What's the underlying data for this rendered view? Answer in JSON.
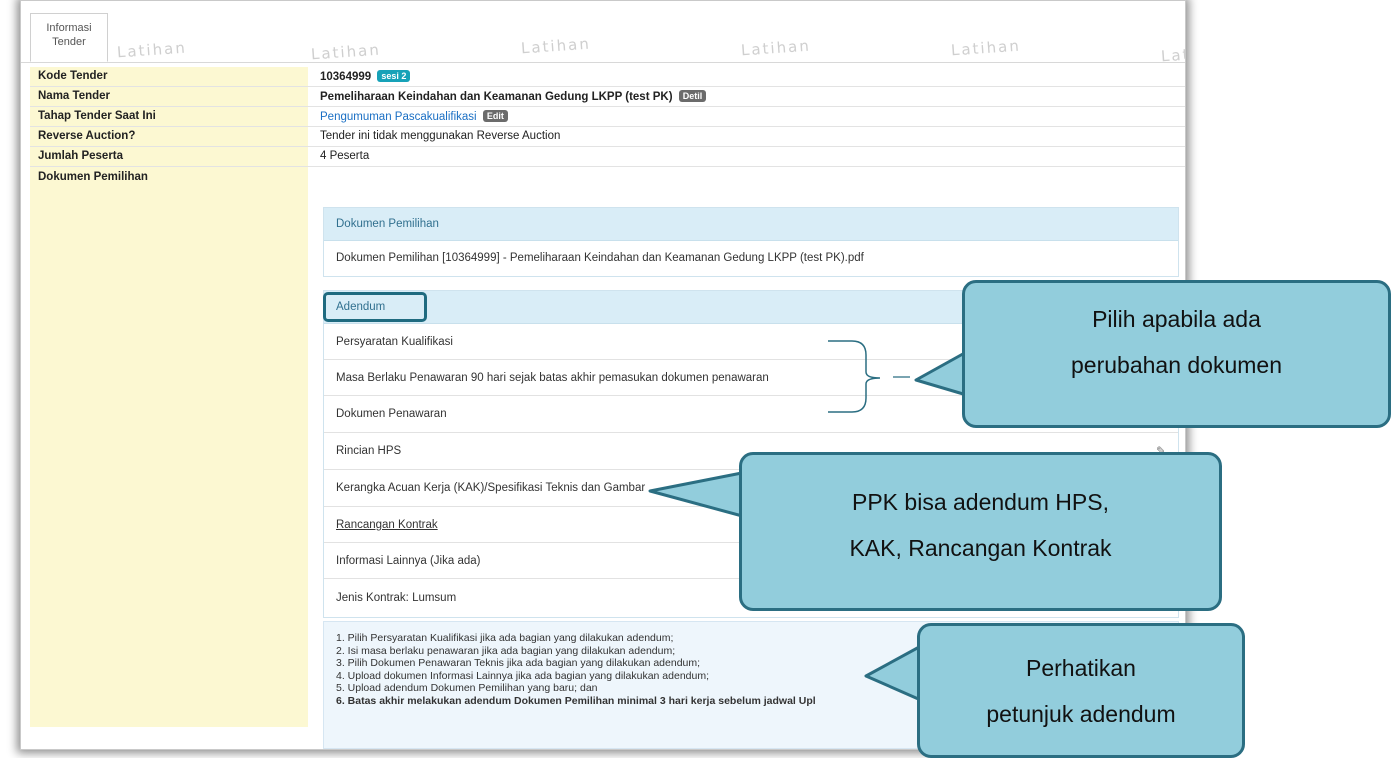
{
  "tab": {
    "line1": "Informasi",
    "line2": "Tender"
  },
  "watermark": "Latihan",
  "rows": [
    {
      "label": "Kode Tender",
      "value": "10364999",
      "badge": "sesi 2"
    },
    {
      "label": "Nama Tender",
      "value": "Pemeliharaan Keindahan dan Keamanan Gedung LKPP (test PK)",
      "badge": "Detil"
    },
    {
      "label": "Tahap Tender Saat Ini",
      "value": "Pengumuman Pascakualifikasi",
      "badge": "Edit"
    },
    {
      "label": "Reverse Auction?",
      "value": "Tender ini tidak menggunakan Reverse Auction"
    },
    {
      "label": "Jumlah Peserta",
      "value": "4 Peserta"
    },
    {
      "label": "Dokumen Pemilihan"
    }
  ],
  "dok_panel": {
    "header": "Dokumen Pemilihan",
    "file": "Dokumen Pemilihan [10364999] - Pemeliharaan Keindahan dan Keamanan Gedung LKPP (test PK).pdf"
  },
  "adendum_panel": {
    "header": "Adendum",
    "items": [
      "Persyaratan Kualifikasi",
      "Masa Berlaku Penawaran 90 hari sejak batas akhir pemasukan dokumen penawaran",
      "Dokumen Penawaran",
      "Rincian HPS",
      "Kerangka Acuan Kerja (KAK)/Spesifikasi Teknis dan Gambar",
      "Rancangan Kontrak",
      "Informasi Lainnya (Jika ada)",
      "Jenis Kontrak: Lumsum"
    ]
  },
  "notes": [
    "1. Pilih Persyaratan Kualifikasi jika ada bagian yang dilakukan adendum;",
    "2. Isi masa berlaku penawaran jika ada bagian yang dilakukan adendum;",
    "3. Pilih Dokumen Penawaran Teknis jika ada bagian yang dilakukan adendum;",
    "4. Upload dokumen Informasi Lainnya jika ada bagian yang dilakukan adendum;",
    "5. Upload adendum Dokumen Pemilihan yang baru; dan",
    "6. Batas akhir melakukan adendum Dokumen Pemilihan minimal 3 hari kerja sebelum jadwal Upl"
  ],
  "callouts": {
    "c1": [
      "Pilih apabila ada",
      "perubahan dokumen"
    ],
    "c2": [
      "PPK bisa adendum HPS,",
      "KAK, Rancangan Kontrak"
    ],
    "c3": [
      "Perhatikan",
      "petunjuk adendum"
    ]
  },
  "colors": {
    "label_bg": "#fcf8d2",
    "panel_header": "#d9edf7",
    "callout_fill": "#92cddc",
    "callout_border": "#2b6e82",
    "badge_teal": "#17a2b8"
  }
}
